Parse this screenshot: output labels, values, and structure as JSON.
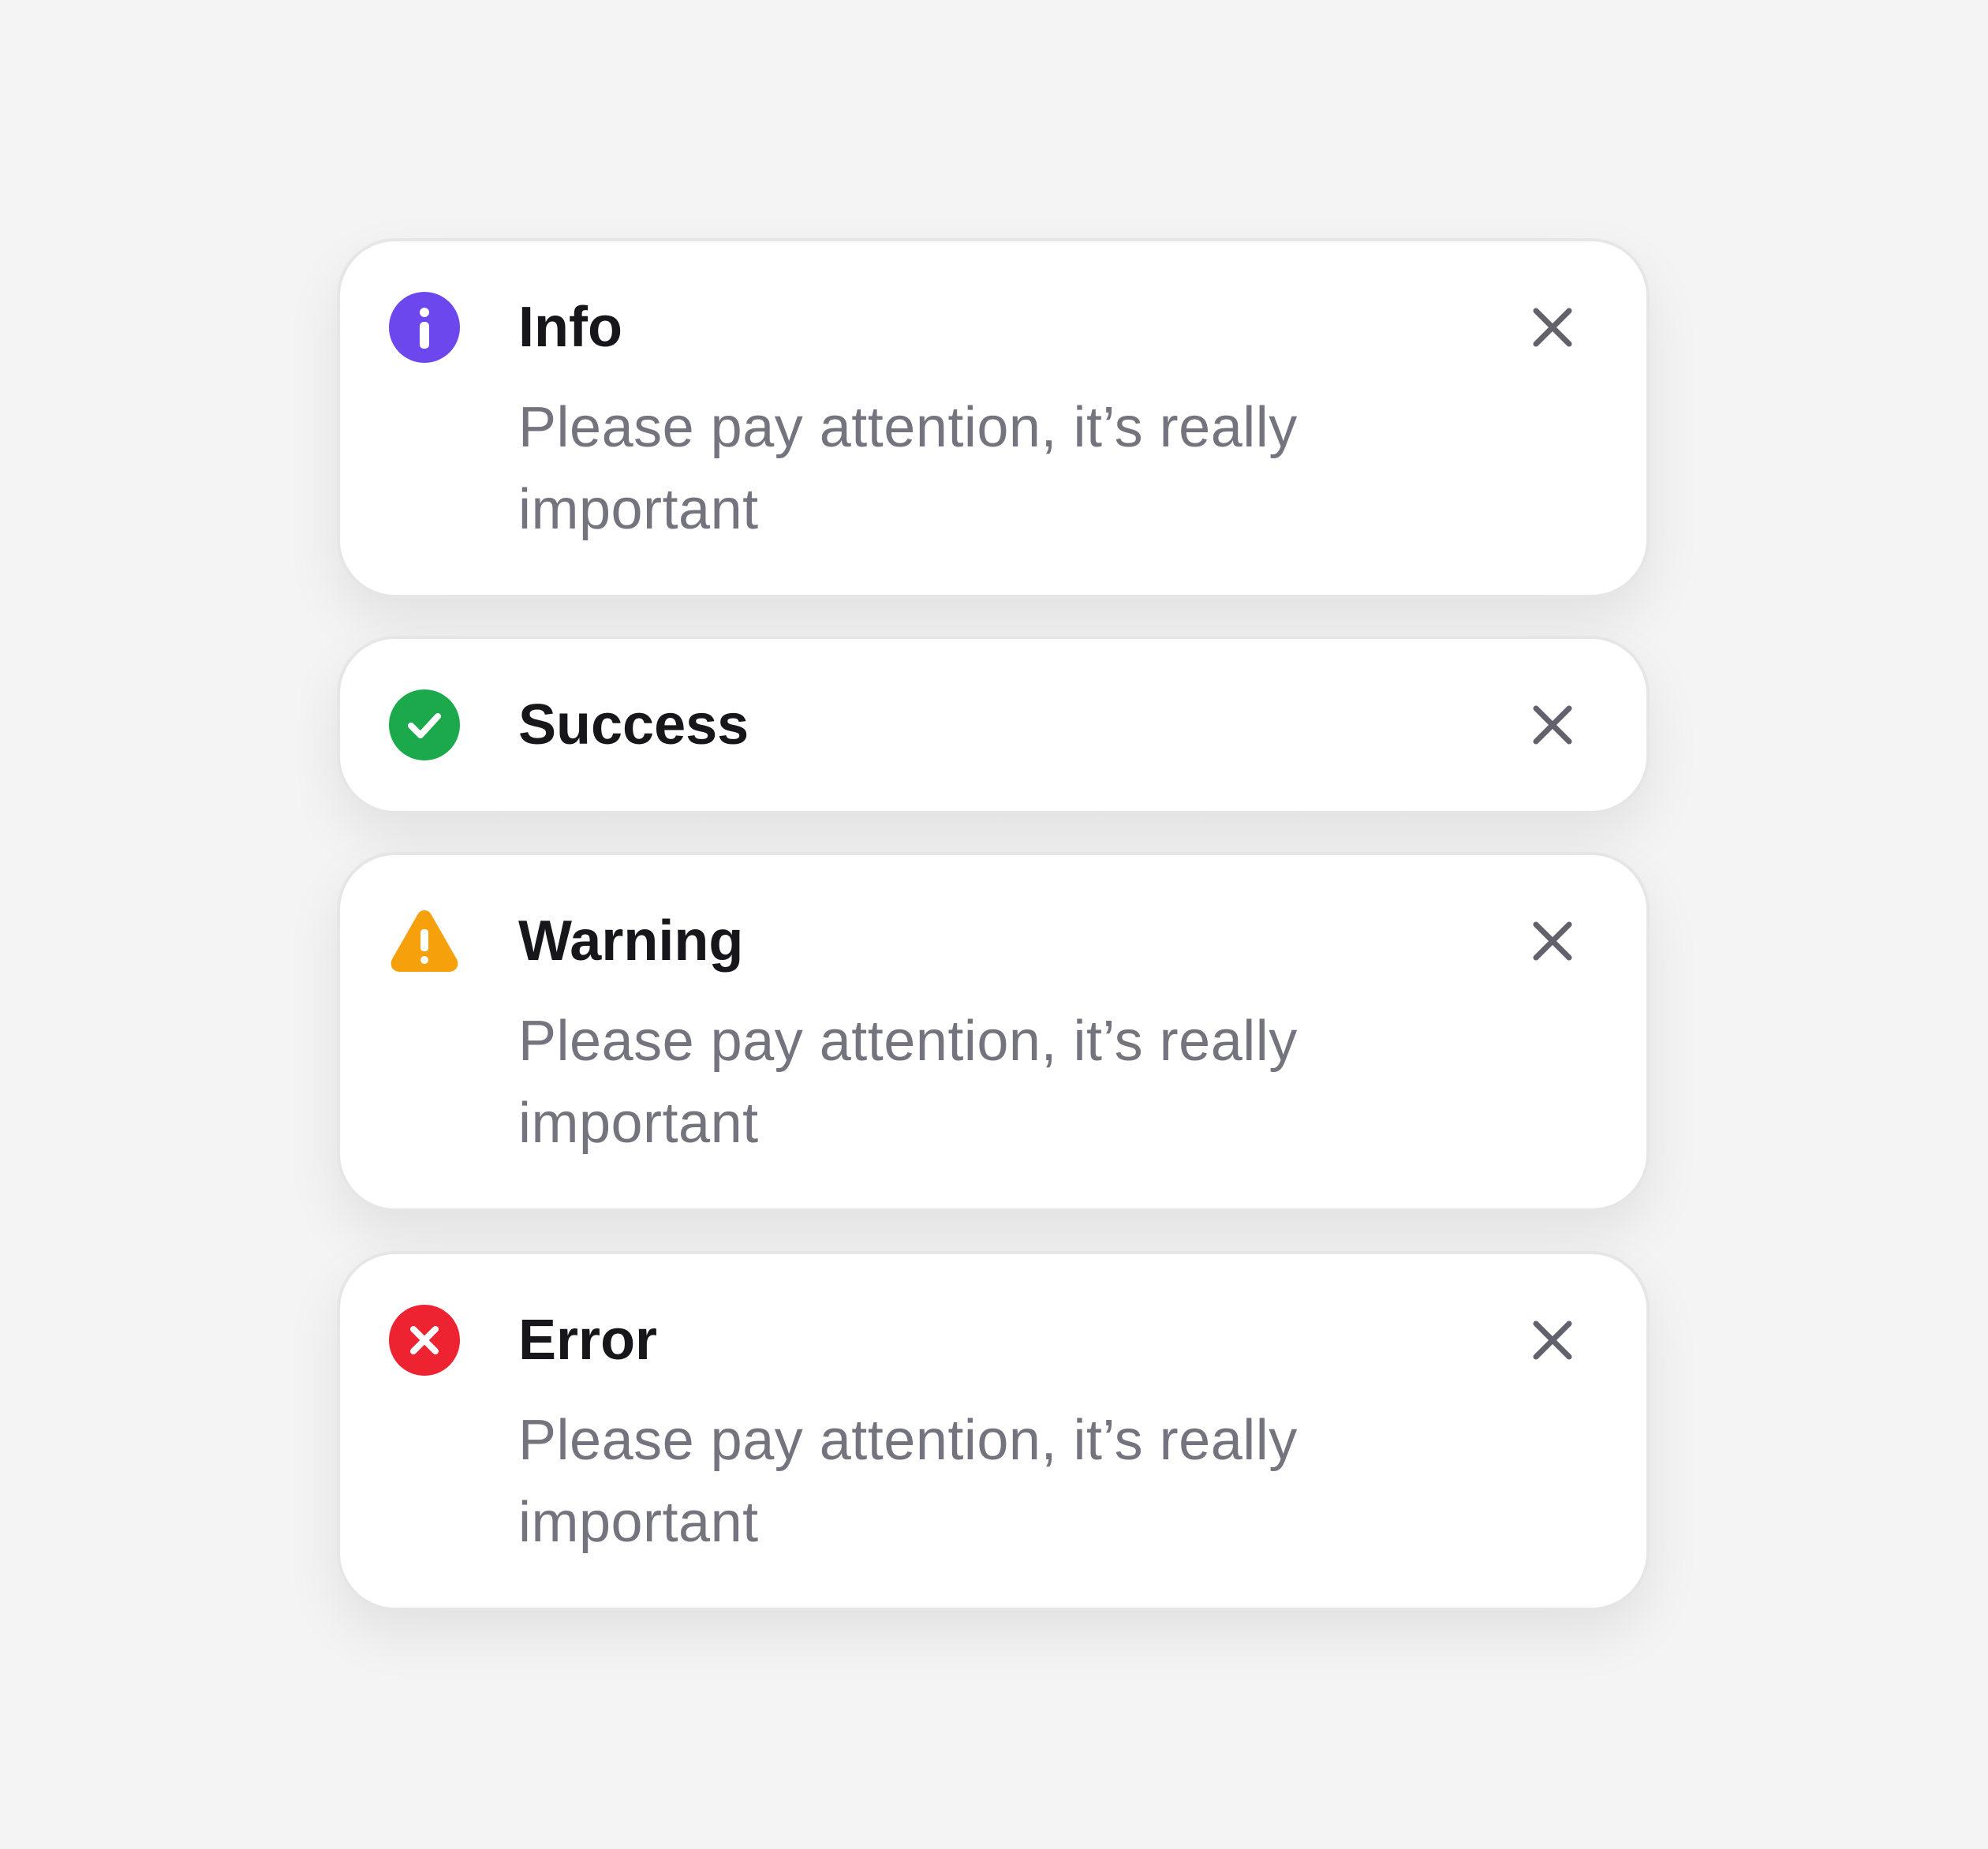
{
  "notifications": [
    {
      "type": "info",
      "title": "Info",
      "message": "Please pay attention, it’s really important",
      "icon": "info-icon",
      "color": "#6c47ee"
    },
    {
      "type": "success",
      "title": "Success",
      "message": "",
      "icon": "check-circle-icon",
      "color": "#1ba94c"
    },
    {
      "type": "warning",
      "title": "Warning",
      "message": "Please pay attention, it’s really important",
      "icon": "warning-triangle-icon",
      "color": "#f6a10c"
    },
    {
      "type": "error",
      "title": "Error",
      "message": "Please pay attention, it’s really important",
      "icon": "error-x-icon",
      "color": "#ee2332"
    }
  ],
  "close_icon": "close-icon",
  "close_icon_color": "#62626c"
}
